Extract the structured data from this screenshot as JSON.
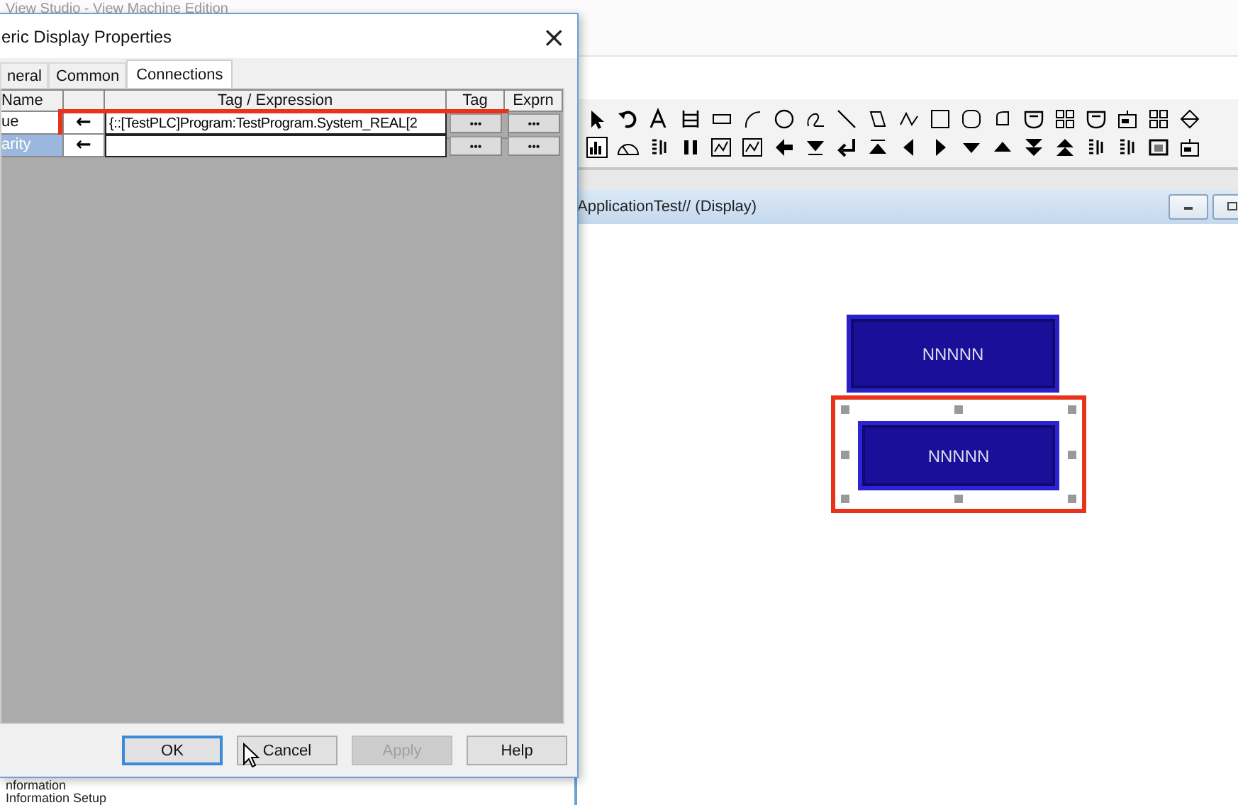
{
  "app": {
    "title": "View Studio - View Machine Edition"
  },
  "side_panel": {
    "items": [
      {
        "label": "nformation"
      },
      {
        "label": "Information Setup"
      }
    ]
  },
  "display_window": {
    "title": "ApplicationTest// (Display)",
    "displays": [
      {
        "text": "NNNNN",
        "selected": false,
        "highlighted": false
      },
      {
        "text": "NNNNN",
        "selected": true,
        "highlighted": true
      }
    ]
  },
  "dialog": {
    "title": "eric Display Properties",
    "close": "×",
    "tabs": [
      {
        "label": "neral",
        "selected": false
      },
      {
        "label": "Common",
        "selected": false
      },
      {
        "label": "Connections",
        "selected": true
      }
    ],
    "table": {
      "columns": [
        {
          "label": "Name"
        },
        {
          "label": "Tag / Expression"
        },
        {
          "label": "Tag"
        },
        {
          "label": "Exprn"
        }
      ],
      "rows": [
        {
          "name": "ue",
          "arrow": "←",
          "value": "{::[TestPLC]Program:TestProgram.System_REAL[2",
          "tag_button": "•••",
          "exprn_button": "•••",
          "selected": false,
          "highlighted": true
        },
        {
          "name": "arity",
          "arrow": "←",
          "value": "",
          "tag_button": "•••",
          "exprn_button": "•••",
          "selected": true,
          "highlighted": false
        }
      ]
    },
    "buttons": [
      {
        "label": "OK",
        "default": true,
        "disabled": false
      },
      {
        "label": "Cancel",
        "default": false,
        "disabled": false
      },
      {
        "label": "Apply",
        "default": false,
        "disabled": true
      },
      {
        "label": "Help",
        "default": false,
        "disabled": false
      }
    ]
  }
}
